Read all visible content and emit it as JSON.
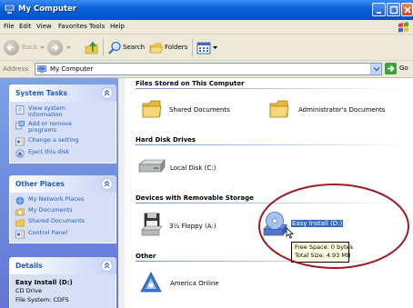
{
  "window": {
    "title": "My Computer"
  },
  "menubar": {
    "items": [
      "File",
      "Edit",
      "View",
      "Favorites",
      "Tools",
      "Help"
    ]
  },
  "toolbar": {
    "back_label": "Back",
    "search_label": "Search",
    "folders_label": "Folders"
  },
  "address": {
    "label": "Address",
    "value": "My Computer",
    "go_label": "Go"
  },
  "tasks": {
    "system": {
      "title": "System Tasks",
      "items": [
        "View system information",
        "Add or remove programs",
        "Change a setting",
        "Eject this disk"
      ]
    },
    "places": {
      "title": "Other Places",
      "items": [
        "My Network Places",
        "My Documents",
        "Shared Documents",
        "Control Panel"
      ]
    },
    "details": {
      "title": "Details",
      "name": "Easy Install (D:)",
      "type": "CD Drive",
      "filesystem": "File System: CDFS"
    }
  },
  "main": {
    "groups": [
      {
        "title": "Files Stored on This Computer",
        "items": [
          "Shared Documents",
          "Administrator's Documents"
        ]
      },
      {
        "title": "Hard Disk Drives",
        "items": [
          "Local Disk (C:)"
        ]
      },
      {
        "title": "Devices with Removable Storage",
        "items": [
          "3½ Floppy (A:)",
          "Easy Install (D:)"
        ]
      },
      {
        "title": "Other",
        "items": [
          "America Online"
        ]
      }
    ]
  },
  "tooltip": {
    "line1": "Free Space: 0 bytes",
    "line2": "Total Size: 4.93 MB"
  },
  "colors": {
    "titlebar": "#0a5fd8",
    "taskpane": "#7ba2e7",
    "link": "#215dc6",
    "selection": "#316ac5",
    "annotation": "#9b1a23"
  }
}
